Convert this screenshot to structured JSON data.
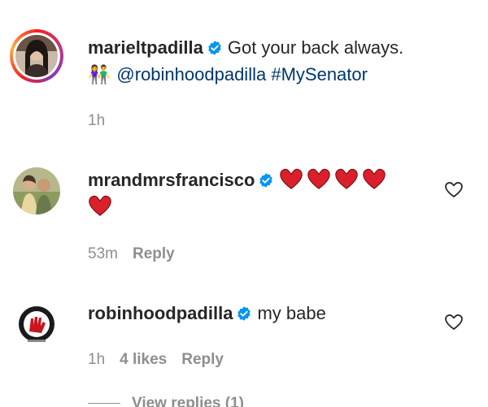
{
  "comments": [
    {
      "username": "marieltpadilla",
      "text": "Got your back always.",
      "emoji": "👫",
      "mention": "@robinhoodpadilla",
      "hashtag": "#MySenator",
      "time": "1h"
    },
    {
      "username": "mrandmrsfrancisco",
      "hearts_count": 5,
      "time": "53m",
      "reply_label": "Reply"
    },
    {
      "username": "robinhoodpadilla",
      "text": "my babe",
      "time": "1h",
      "likes": "4 likes",
      "reply_label": "Reply"
    }
  ],
  "view_replies_label": "View replies (1)",
  "colors": {
    "text": "#262626",
    "muted": "#8e8e8e",
    "link": "#00376b",
    "verified": "#0095f6",
    "heart": "#ed4956"
  }
}
